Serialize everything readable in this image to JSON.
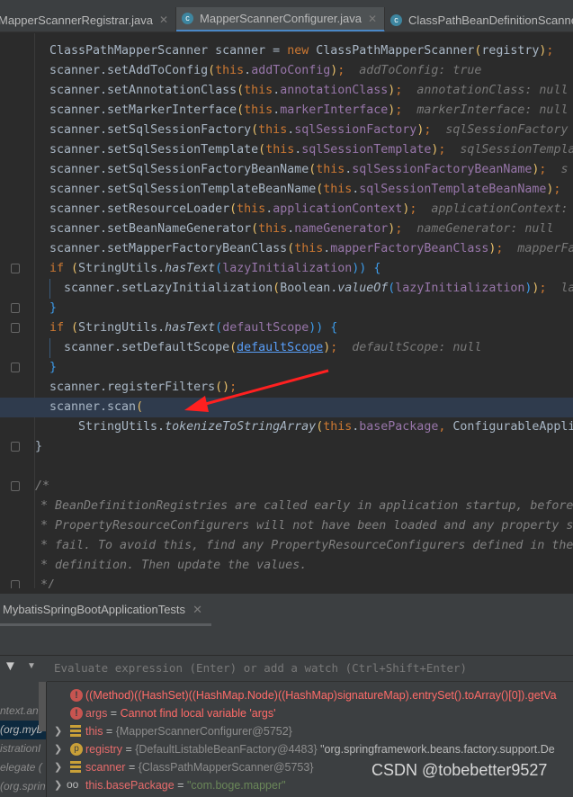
{
  "editor_tabs": [
    {
      "label": "MapperScannerRegistrar.java",
      "active": false,
      "icon": "class-icon"
    },
    {
      "label": "MapperScannerConfigurer.java",
      "active": true,
      "icon": "class-icon"
    },
    {
      "label": "ClassPathBeanDefinitionScanner.java",
      "active": false,
      "icon": "class-icon"
    }
  ],
  "colors": {
    "background": "#2b2b2b",
    "keyword": "#cc7832",
    "field": "#9876aa",
    "text": "#a9b7c6",
    "execution_line": "#2f3b4d",
    "error": "#ff6b68",
    "annotation_arrow": "#ff2020"
  },
  "code_lines": [
    {
      "indent": 0,
      "tokens": [
        [
          "",
          "ClassPathMapperScanner scanner = "
        ],
        [
          "k",
          "new"
        ],
        [
          "",
          " ClassPathMapperScanner"
        ],
        [
          "p",
          "("
        ],
        [
          "",
          "registry"
        ],
        [
          "p",
          ")"
        ],
        [
          "k",
          ";"
        ]
      ]
    },
    {
      "indent": 0,
      "tokens": [
        [
          "",
          "scanner.setAddToConfig"
        ],
        [
          "p",
          "("
        ],
        [
          "k",
          "this"
        ],
        [
          "",
          "."
        ],
        [
          "f",
          "addToConfig"
        ],
        [
          "p",
          ")"
        ],
        [
          "k",
          ";"
        ],
        [
          "h",
          "  addToConfig: true"
        ]
      ]
    },
    {
      "indent": 0,
      "tokens": [
        [
          "",
          "scanner.setAnnotationClass"
        ],
        [
          "p",
          "("
        ],
        [
          "k",
          "this"
        ],
        [
          "",
          "."
        ],
        [
          "f",
          "annotationClass"
        ],
        [
          "p",
          ")"
        ],
        [
          "k",
          ";"
        ],
        [
          "h",
          "  annotationClass: null"
        ]
      ]
    },
    {
      "indent": 0,
      "tokens": [
        [
          "",
          "scanner.setMarkerInterface"
        ],
        [
          "p",
          "("
        ],
        [
          "k",
          "this"
        ],
        [
          "",
          "."
        ],
        [
          "f",
          "markerInterface"
        ],
        [
          "p",
          ")"
        ],
        [
          "k",
          ";"
        ],
        [
          "h",
          "  markerInterface: null"
        ]
      ]
    },
    {
      "indent": 0,
      "tokens": [
        [
          "",
          "scanner.setSqlSessionFactory"
        ],
        [
          "p",
          "("
        ],
        [
          "k",
          "this"
        ],
        [
          "",
          "."
        ],
        [
          "f",
          "sqlSessionFactory"
        ],
        [
          "p",
          ")"
        ],
        [
          "k",
          ";"
        ],
        [
          "h",
          "  sqlSessionFactory"
        ]
      ]
    },
    {
      "indent": 0,
      "tokens": [
        [
          "",
          "scanner.setSqlSessionTemplate"
        ],
        [
          "p",
          "("
        ],
        [
          "k",
          "this"
        ],
        [
          "",
          "."
        ],
        [
          "f",
          "sqlSessionTemplate"
        ],
        [
          "p",
          ")"
        ],
        [
          "k",
          ";"
        ],
        [
          "h",
          "  sqlSessionTemplate"
        ]
      ]
    },
    {
      "indent": 0,
      "tokens": [
        [
          "",
          "scanner.setSqlSessionFactoryBeanName"
        ],
        [
          "p",
          "("
        ],
        [
          "k",
          "this"
        ],
        [
          "",
          "."
        ],
        [
          "f",
          "sqlSessionFactoryBeanName"
        ],
        [
          "p",
          ")"
        ],
        [
          "k",
          ";"
        ],
        [
          "h",
          "  s"
        ]
      ]
    },
    {
      "indent": 0,
      "tokens": [
        [
          "",
          "scanner.setSqlSessionTemplateBeanName"
        ],
        [
          "p",
          "("
        ],
        [
          "k",
          "this"
        ],
        [
          "",
          "."
        ],
        [
          "f",
          "sqlSessionTemplateBeanName"
        ],
        [
          "p",
          ")"
        ],
        [
          "k",
          ";"
        ]
      ]
    },
    {
      "indent": 0,
      "tokens": [
        [
          "",
          "scanner.setResourceLoader"
        ],
        [
          "p",
          "("
        ],
        [
          "k",
          "this"
        ],
        [
          "",
          "."
        ],
        [
          "f",
          "applicationContext"
        ],
        [
          "p",
          ")"
        ],
        [
          "k",
          ";"
        ],
        [
          "h",
          "  applicationContext:"
        ]
      ]
    },
    {
      "indent": 0,
      "tokens": [
        [
          "",
          "scanner.setBeanNameGenerator"
        ],
        [
          "p",
          "("
        ],
        [
          "k",
          "this"
        ],
        [
          "",
          "."
        ],
        [
          "f",
          "nameGenerator"
        ],
        [
          "p",
          ")"
        ],
        [
          "k",
          ";"
        ],
        [
          "h",
          "  nameGenerator: null"
        ]
      ]
    },
    {
      "indent": 0,
      "tokens": [
        [
          "",
          "scanner.setMapperFactoryBeanClass"
        ],
        [
          "p",
          "("
        ],
        [
          "k",
          "this"
        ],
        [
          "",
          "."
        ],
        [
          "f",
          "mapperFactoryBeanClass"
        ],
        [
          "p",
          ")"
        ],
        [
          "k",
          ";"
        ],
        [
          "h",
          "  mapperFa"
        ]
      ]
    },
    {
      "indent": 0,
      "tokens": [
        [
          "k",
          "if"
        ],
        [
          "",
          " "
        ],
        [
          "p",
          "("
        ],
        [
          "",
          "StringUtils."
        ],
        [
          "i",
          "hasText"
        ],
        [
          "b",
          "("
        ],
        [
          "f",
          "lazyInitialization"
        ],
        [
          "b",
          "))"
        ],
        [
          "",
          " "
        ],
        [
          "b",
          "{"
        ]
      ]
    },
    {
      "indent": 1,
      "tokens": [
        [
          "",
          "scanner.setLazyInitialization"
        ],
        [
          "p",
          "("
        ],
        [
          "",
          "Boolean."
        ],
        [
          "i",
          "valueOf"
        ],
        [
          "b",
          "("
        ],
        [
          "f",
          "lazyInitialization"
        ],
        [
          "b",
          ")"
        ],
        [
          "p",
          ")"
        ],
        [
          "k",
          ";"
        ],
        [
          "h",
          "  la"
        ]
      ]
    },
    {
      "indent": 0,
      "tokens": [
        [
          "b",
          "}"
        ]
      ]
    },
    {
      "indent": 0,
      "tokens": [
        [
          "k",
          "if"
        ],
        [
          "",
          " "
        ],
        [
          "p",
          "("
        ],
        [
          "",
          "StringUtils."
        ],
        [
          "i",
          "hasText"
        ],
        [
          "b",
          "("
        ],
        [
          "f",
          "defaultScope"
        ],
        [
          "b",
          "))"
        ],
        [
          "",
          " "
        ],
        [
          "b",
          "{"
        ]
      ]
    },
    {
      "indent": 1,
      "tokens": [
        [
          "",
          "scanner.setDefaultScope"
        ],
        [
          "p",
          "("
        ],
        [
          "u",
          "defaultScope"
        ],
        [
          "p",
          ")"
        ],
        [
          "k",
          ";"
        ],
        [
          "h",
          "  defaultScope: null"
        ]
      ]
    },
    {
      "indent": 0,
      "tokens": [
        [
          "b",
          "}"
        ]
      ]
    },
    {
      "indent": 0,
      "tokens": [
        [
          "",
          "scanner.registerFilters"
        ],
        [
          "p",
          "()"
        ],
        [
          "k",
          ";"
        ]
      ]
    },
    {
      "indent": 0,
      "highlight": true,
      "tokens": [
        [
          "",
          "scanner.scan"
        ],
        [
          "p",
          "("
        ]
      ]
    },
    {
      "indent": 2,
      "tokens": [
        [
          "",
          "StringUtils."
        ],
        [
          "i",
          "tokenizeToStringArray"
        ],
        [
          "p",
          "("
        ],
        [
          "k",
          "this"
        ],
        [
          "",
          "."
        ],
        [
          "f",
          "basePackage"
        ],
        [
          "k",
          ","
        ],
        [
          "",
          " ConfigurableAppli"
        ]
      ]
    },
    {
      "indent": -1,
      "tokens": [
        [
          "",
          "}"
        ]
      ]
    },
    {
      "indent": -1,
      "tokens": []
    },
    {
      "indent": -1,
      "tokens": [
        [
          "c",
          "/*"
        ]
      ]
    },
    {
      "indent": -2,
      "tokens": [
        [
          "c",
          "* BeanDefinitionRegistries are called early in application startup, before"
        ]
      ]
    },
    {
      "indent": -2,
      "tokens": [
        [
          "c",
          "* PropertyResourceConfigurers will not have been loaded and any property s"
        ]
      ]
    },
    {
      "indent": -2,
      "tokens": [
        [
          "c",
          "* fail. To avoid this, find any PropertyResourceConfigurers defined in the"
        ]
      ]
    },
    {
      "indent": -2,
      "tokens": [
        [
          "c",
          "* definition. Then update the values."
        ]
      ]
    },
    {
      "indent": -2,
      "tokens": [
        [
          "c",
          "*/"
        ]
      ]
    }
  ],
  "debug": {
    "tab_label": "MybatisSpringBootApplicationTests",
    "evaluate_placeholder": "Evaluate expression (Enter) or add a watch (Ctrl+Shift+Enter)",
    "frames": [
      "ntext.ann",
      "(org.myb",
      "istrationI",
      "elegate (",
      "(org.sprin",
      "ext.supp"
    ],
    "selected_frame": 1,
    "variables": [
      {
        "icon": "error-icon",
        "expandable": false,
        "name": "((Method)((HashSet)((HashMap.Node)((HashMap)signatureMap).entrySet().toArray()[0]).getVa",
        "eq": "",
        "value": "",
        "extra": ""
      },
      {
        "icon": "error-icon",
        "expandable": false,
        "name": "args",
        "eq": " = ",
        "value": "Cannot find local variable 'args'",
        "extra": ""
      },
      {
        "icon": "field-icon",
        "expandable": true,
        "name": "this",
        "eq": " = ",
        "value": "{MapperScannerConfigurer@5752}",
        "extra": ""
      },
      {
        "icon": "parameter-icon",
        "expandable": true,
        "name": "registry",
        "eq": " = ",
        "value": "{DefaultListableBeanFactory@4483}",
        "extra": " \"org.springframework.beans.factory.support.De"
      },
      {
        "icon": "field-icon",
        "expandable": true,
        "name": "scanner",
        "eq": " = ",
        "value": "{ClassPathMapperScanner@5753}",
        "extra": ""
      },
      {
        "icon": "watch-icon",
        "expandable": true,
        "name": "this.basePackage",
        "eq": " = ",
        "value": "\"com.boge.mapper\"",
        "extra": ""
      }
    ]
  },
  "watermark": "CSDN @tobebetter9527"
}
